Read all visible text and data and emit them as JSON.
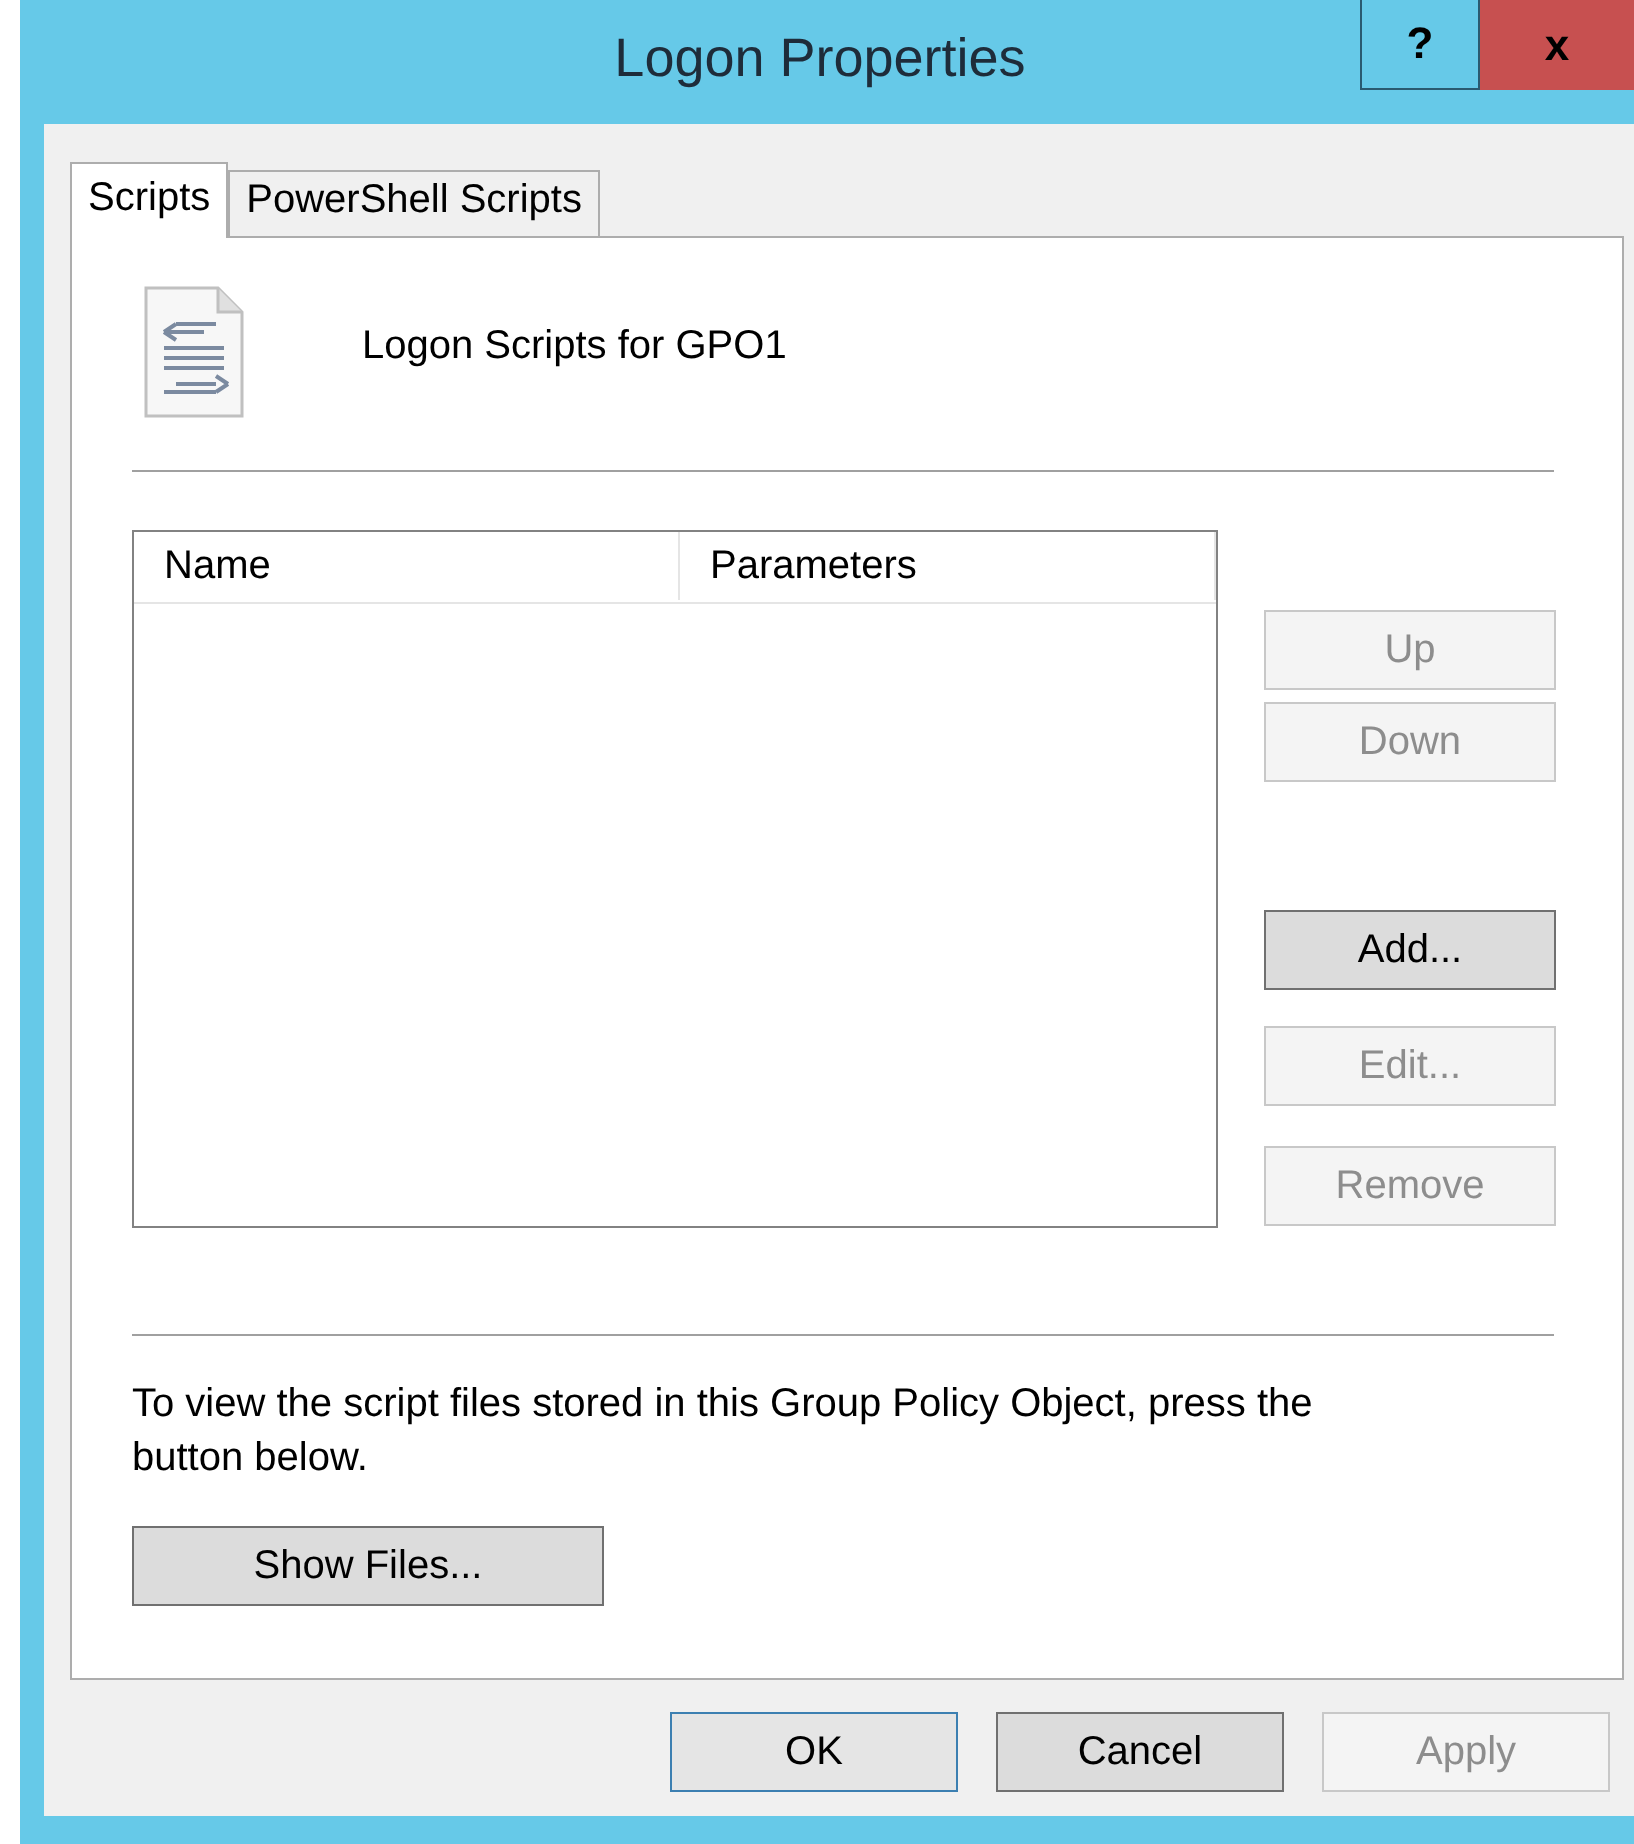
{
  "window": {
    "title": "Logon Properties",
    "title_buttons": [
      "?",
      "x"
    ]
  },
  "tabs": [
    {
      "label": "Scripts",
      "selected": true
    },
    {
      "label": "PowerShell Scripts",
      "selected": false
    }
  ],
  "heading": "Logon Scripts for GPO1",
  "table": {
    "columns": [
      "Name",
      "Parameters"
    ]
  },
  "side_buttons": [
    {
      "label": "Up",
      "disabled": true
    },
    {
      "label": "Down",
      "disabled": true
    },
    {
      "label": "Add...",
      "disabled": false
    },
    {
      "label": "Edit...",
      "disabled": true
    },
    {
      "label": "Remove",
      "disabled": true
    }
  ],
  "note": "To view the script files stored in this Group Policy Object, press the button below.",
  "show_files_button": {
    "label": "Show Files...",
    "disabled": false
  },
  "dialog_buttons": [
    {
      "label": "OK",
      "disabled": false,
      "default": true
    },
    {
      "label": "Cancel",
      "disabled": false,
      "default": false
    },
    {
      "label": "Apply",
      "disabled": true,
      "default": false
    }
  ]
}
